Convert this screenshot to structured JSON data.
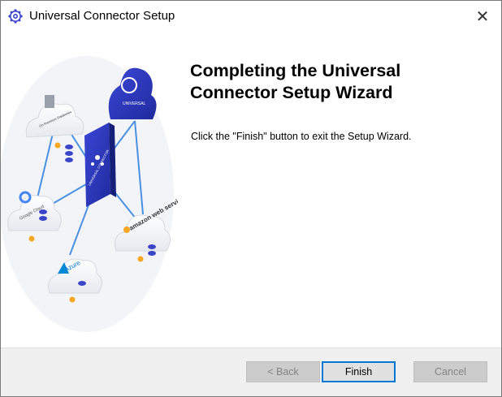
{
  "window": {
    "title": "Universal Connector Setup"
  },
  "heading": "Completing the Universal Connector Setup Wizard",
  "body_text": "Click the \"Finish\" button to exit the Setup Wizard.",
  "illustration": {
    "hub_label": "UNIVERSAL CONNECTOR",
    "cloud_labels": [
      "On Premises Databases",
      "Google Cloud",
      "amazon web services",
      "Azure",
      "UNIVERSAL"
    ]
  },
  "buttons": {
    "back": "< Back",
    "finish": "Finish",
    "cancel": "Cancel"
  },
  "colors": {
    "accent": "#0078d7",
    "brand_blue": "#2f3db8"
  }
}
